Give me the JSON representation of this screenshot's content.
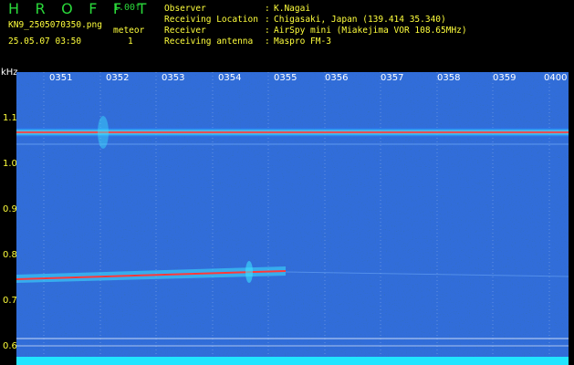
{
  "header": {
    "brand": "H R O F F T",
    "version": "1.00f",
    "filename": "KN9_2505070350.png",
    "mode_label": "meteor",
    "mode_value": "1",
    "datetime": "25.05.07 03:50"
  },
  "meta": [
    {
      "label": "Observer",
      "value": "K.Nagai"
    },
    {
      "label": "Receiving Location",
      "value": "Chigasaki, Japan (139.414 35.340)"
    },
    {
      "label": "Receiver",
      "value": "AirSpy mini (Miakejima VOR 108.65MHz)"
    },
    {
      "label": "Receiving antenna",
      "value": "Maspro FM-3"
    }
  ],
  "spectrogram": {
    "y_unit": "kHz",
    "y_ticks": [
      "1.1",
      "1.0",
      "0.9",
      "0.8",
      "0.7",
      "0.6"
    ],
    "x_ticks": [
      "0351",
      "0352",
      "0353",
      "0354",
      "0355",
      "0356",
      "0357",
      "0358",
      "0359",
      "0400"
    ],
    "background_color": "#0a1a6e"
  }
}
